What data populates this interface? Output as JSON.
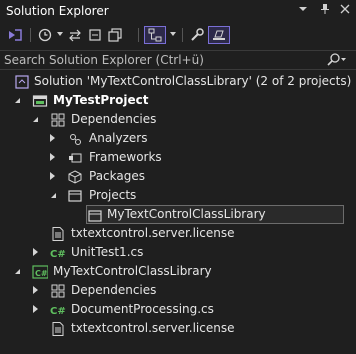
{
  "window": {
    "title": "Solution Explorer"
  },
  "title_buttons": [
    "dropdown-icon",
    "pin-icon",
    "close-icon"
  ],
  "search": {
    "placeholder": "Search Solution Explorer (Ctrl+ü)"
  },
  "tree": [
    {
      "label": "Solution 'MyTextControlClassLibrary' (2 of 2 projects)",
      "icon": "solution-icon"
    },
    {
      "label": "MyTestProject",
      "icon": "console-project-icon",
      "bold": true
    },
    {
      "label": "Dependencies",
      "icon": "dependencies-icon"
    },
    {
      "label": "Analyzers",
      "icon": "analyzer-icon"
    },
    {
      "label": "Frameworks",
      "icon": "framework-icon"
    },
    {
      "label": "Packages",
      "icon": "package-icon"
    },
    {
      "label": "Projects",
      "icon": "projects-icon"
    },
    {
      "label": "MyTextControlClassLibrary",
      "icon": "project-reference-icon",
      "selected": true
    },
    {
      "label": "txtextcontrol.server.license",
      "icon": "file-icon"
    },
    {
      "label": "UnitTest1.cs",
      "icon": "csharp-file-icon"
    },
    {
      "label": "MyTextControlClassLibrary",
      "icon": "csharp-project-icon"
    },
    {
      "label": "Dependencies",
      "icon": "dependencies-icon"
    },
    {
      "label": "DocumentProcessing.cs",
      "icon": "csharp-file-icon"
    },
    {
      "label": "txtextcontrol.server.license",
      "icon": "file-icon"
    }
  ],
  "colors": {
    "accent": "#7a6fd6",
    "csharp": "#5fbf5f",
    "background": "#1f1f1f"
  }
}
